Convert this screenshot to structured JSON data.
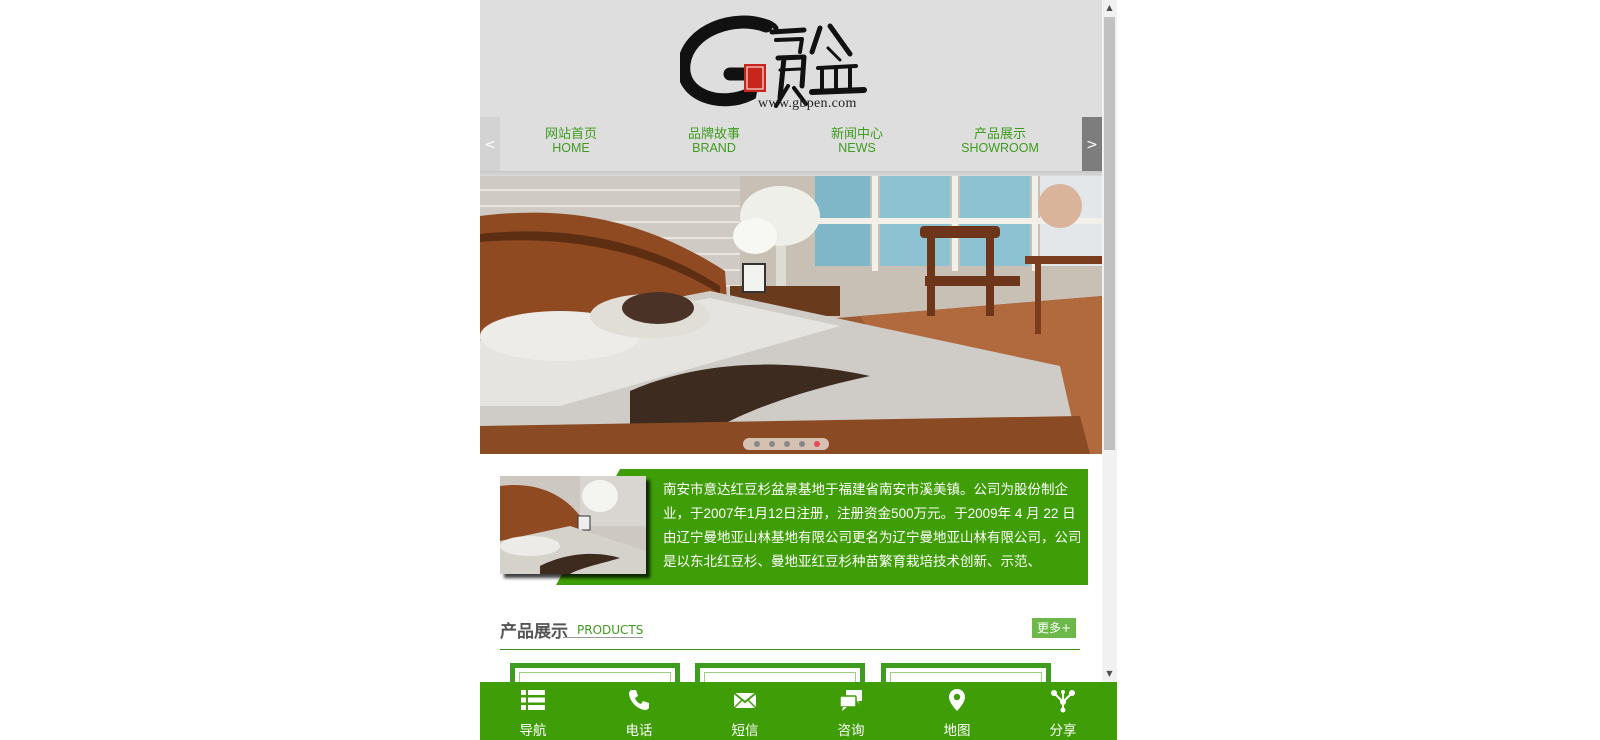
{
  "header": {
    "logo_text": "G寶盆",
    "logo_url": "www.gbpen.com"
  },
  "nav": {
    "prev": "<",
    "next": ">",
    "items": [
      {
        "label": "网站首页",
        "en": "HOME"
      },
      {
        "label": "品牌故事",
        "en": "BRAND"
      },
      {
        "label": "新闻中心",
        "en": "NEWS"
      },
      {
        "label": "产品展示",
        "en": "SHOWROOM"
      }
    ]
  },
  "banner": {
    "dot_count": 5,
    "active_dot": 5
  },
  "about": {
    "text": "南安市意达红豆杉盆景基地于福建省南安市溪美镇。公司为股份制企业，于2007年1月12日注册，注册资金500万元。于2009年 4 月 22 日由辽宁曼地亚山林基地有限公司更名为辽宁曼地亚山林有限公司，公司是以东北红豆杉、曼地亚红豆杉种苗繁育栽培技术创新、示范、"
  },
  "products": {
    "title": "产品展示",
    "subtitle": "PRODUCTS",
    "more": "更多+"
  },
  "bottom_bar": {
    "items": [
      {
        "label": "导航",
        "icon": "list-icon"
      },
      {
        "label": "电话",
        "icon": "phone-icon"
      },
      {
        "label": "短信",
        "icon": "envelope-icon"
      },
      {
        "label": "咨询",
        "icon": "chat-icon"
      },
      {
        "label": "地图",
        "icon": "map-marker-icon"
      },
      {
        "label": "分享",
        "icon": "share-icon"
      }
    ]
  },
  "colors": {
    "brand_green": "#3f9e07",
    "nav_text": "#3f9c1f",
    "header_bg": "#dedede"
  }
}
